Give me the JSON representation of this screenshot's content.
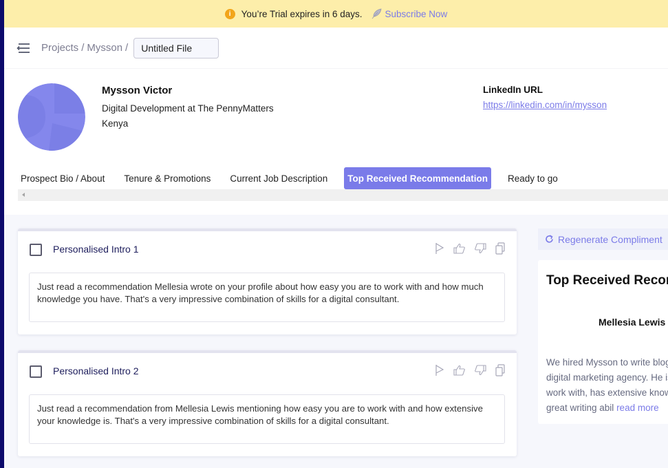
{
  "trial_banner": {
    "message": "You’re Trial expires in 6 days.",
    "cta": "Subscribe Now",
    "info_icon": "info-circle-icon",
    "cta_icon": "feather-icon"
  },
  "topbar": {
    "menu_icon": "collapse-menu-icon",
    "breadcrumb": [
      "Projects",
      "Mysson"
    ],
    "separator": "/",
    "file_name": "Untitled File"
  },
  "profile": {
    "name": "Mysson Victor",
    "title": "Digital Development at The PennyMatters",
    "location": "Kenya",
    "linkedin_label": "LinkedIn URL",
    "linkedin_url": "https://linkedin.com/in/mysson"
  },
  "tabs": [
    {
      "label": "Prospect Bio / About",
      "active": false
    },
    {
      "label": "Tenure & Promotions",
      "active": false
    },
    {
      "label": "Current Job Description",
      "active": false
    },
    {
      "label": "Top Received Recommendation",
      "active": true
    },
    {
      "label": "Ready to go",
      "active": false
    }
  ],
  "intros": [
    {
      "title": "Personalised Intro 1",
      "checked": false,
      "text": "Just read a recommendation Mellesia wrote on your profile about how easy you are to work with and how much knowledge you have. That's a very impressive combination of skills for a digital consultant."
    },
    {
      "title": "Personalised Intro 2",
      "checked": false,
      "text": "Just read a recommendation from Mellesia Lewis mentioning how easy you are to work with and how extensive your knowledge is. That's a very impressive combination of skills for a digital consultant."
    }
  ],
  "card_actions": [
    "flag-icon",
    "thumbs-up-icon",
    "thumbs-down-icon",
    "copy-icon"
  ],
  "side_panel": {
    "regenerate_label": "Regenerate Compliment",
    "title": "Top Received Recommendation",
    "author": "Mellesia Lewis",
    "excerpt": "We hired Mysson to write blogs for our digital marketing agency. He is easy to work with, has extensive knowledge and great writing abil",
    "read_more": "read more"
  },
  "colors": {
    "accent": "#7a7be9",
    "trial_bg": "#fdeeaa",
    "warning": "#f2a51a",
    "rail": "#0c0a6b"
  }
}
